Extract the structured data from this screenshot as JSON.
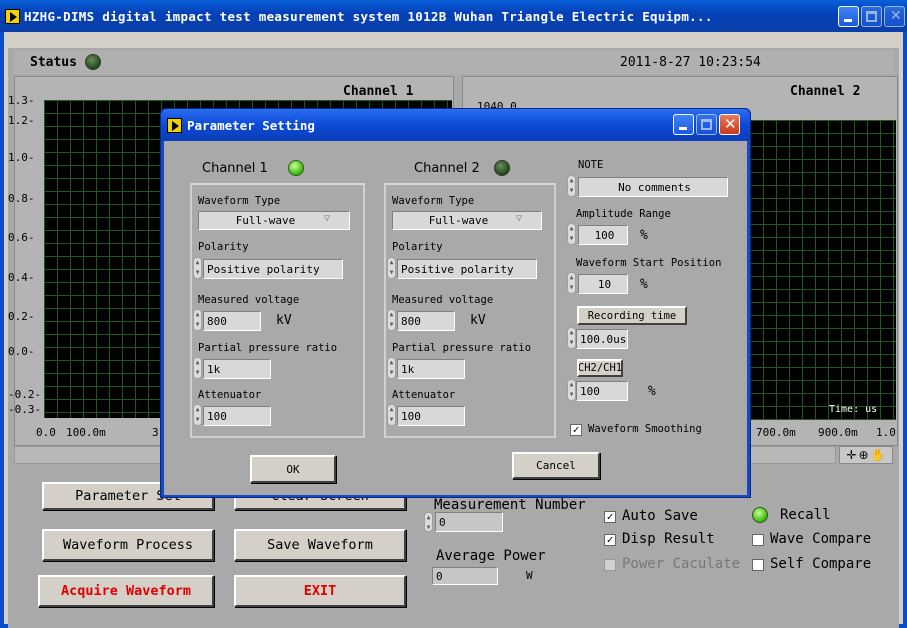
{
  "window": {
    "title": "HZHG-DIMS digital impact test measurement system 1012B Wuhan Triangle Electric Equipm..."
  },
  "status": {
    "label": "Status",
    "datetime": "2011-8-27  10:23:54"
  },
  "channel1": {
    "title": "Channel 1",
    "y_ticks": [
      "1.3",
      "1.2",
      "1.0",
      "0.8",
      "0.6",
      "0.4",
      "0.2",
      "0.0",
      "-0.2",
      "-0.3"
    ],
    "x_ticks": [
      "0.0",
      "100.0m",
      "3"
    ]
  },
  "channel2": {
    "title": "Channel 2",
    "top_value": "1040.0",
    "x_ticks": [
      "700.0m",
      "900.0m",
      "1.0"
    ],
    "time_label": "Time: us"
  },
  "buttons": {
    "parameter_set": "Parameter Set",
    "clear_screen": "Clear Screen",
    "waveform_process": "Waveform Process",
    "save_waveform": "Save Waveform",
    "acquire_waveform": "Acquire Waveform",
    "exit": "EXIT"
  },
  "measurement": {
    "number_label": "Measurement Number",
    "number_value": "0",
    "avg_power_label": "Average Power",
    "avg_power_value": "0",
    "avg_power_unit": "W"
  },
  "options": {
    "auto_save": "Auto Save",
    "disp_result": "Disp Result",
    "power_calculate": "Power Caculate",
    "recall": "Recall",
    "wave_compare": "Wave Compare",
    "self_compare": "Self Compare"
  },
  "dialog": {
    "title": "Parameter Setting",
    "ch1": {
      "label": "Channel 1",
      "waveform_type_label": "Waveform Type",
      "waveform_type": "Full-wave",
      "polarity_label": "Polarity",
      "polarity": "Positive polarity",
      "voltage_label": "Measured voltage",
      "voltage": "800",
      "voltage_unit": "kV",
      "ratio_label": "Partial pressure ratio",
      "ratio": "1k",
      "attenuator_label": "Attenuator",
      "attenuator": "100"
    },
    "ch2": {
      "label": "Channel 2",
      "waveform_type_label": "Waveform Type",
      "waveform_type": "Full-wave",
      "polarity_label": "Polarity",
      "polarity": "Positive polarity",
      "voltage_label": "Measured voltage",
      "voltage": "800",
      "voltage_unit": "kV",
      "ratio_label": "Partial pressure ratio",
      "ratio": "1k",
      "attenuator_label": "Attenuator",
      "attenuator": "100"
    },
    "note_label": "NOTE",
    "note": "No comments",
    "amplitude_label": "Amplitude Range",
    "amplitude": "100",
    "amplitude_unit": "%",
    "start_label": "Waveform Start Position",
    "start": "10",
    "start_unit": "%",
    "recording_label": "Recording time",
    "recording": "100.0us",
    "ratio_btn": "CH2/CH1",
    "ratio_value": "100",
    "ratio_unit": "%",
    "smoothing": "Waveform Smoothing",
    "ok": "OK",
    "cancel": "Cancel"
  }
}
